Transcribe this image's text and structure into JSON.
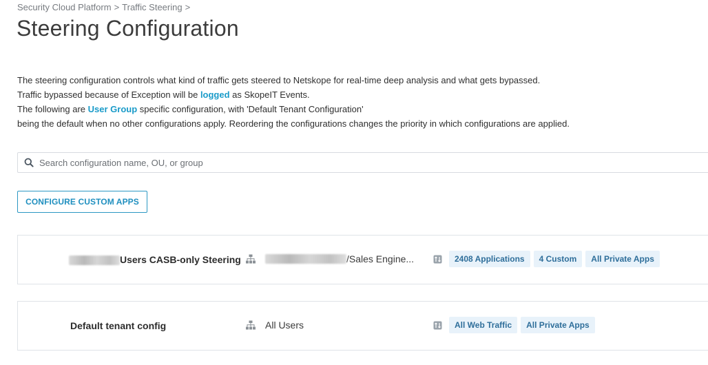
{
  "breadcrumb": {
    "level1": "Security Cloud Platform",
    "level2": "Traffic Steering",
    "sep": ">"
  },
  "page_title": "Steering Configuration",
  "description": {
    "line1": "The steering configuration controls what kind of traffic gets steered to Netskope for real-time deep analysis and what gets bypassed.",
    "line2_pre": "Traffic bypassed because of Exception will be ",
    "line2_link": "logged",
    "line2_post": " as SkopeIT Events.",
    "line3_pre": "The following are ",
    "line3_link": "User Group",
    "line3_post": " specific configuration, with 'Default Tenant Configuration'",
    "line4": "being the default when no other configurations apply. Reordering the configurations changes the priority in which configurations are applied."
  },
  "search": {
    "placeholder": "Search configuration name, OU, or group",
    "icon": "search-icon"
  },
  "custom_apps_button": "CONFIGURE CUSTOM APPS",
  "configs": [
    {
      "name": "Users CASB-only Steering",
      "ou": "/Sales Engine...",
      "tags": [
        "2408 Applications",
        "4 Custom",
        "All Private Apps"
      ]
    },
    {
      "name": "Default tenant config",
      "ou": "All Users",
      "tags": [
        "All Web Traffic",
        "All Private Apps"
      ]
    }
  ],
  "colors": {
    "accent": "#1a9bc9",
    "tag_bg": "#e8f2fa",
    "tag_text": "#2e6e9a",
    "border": "#dfe3e7"
  }
}
